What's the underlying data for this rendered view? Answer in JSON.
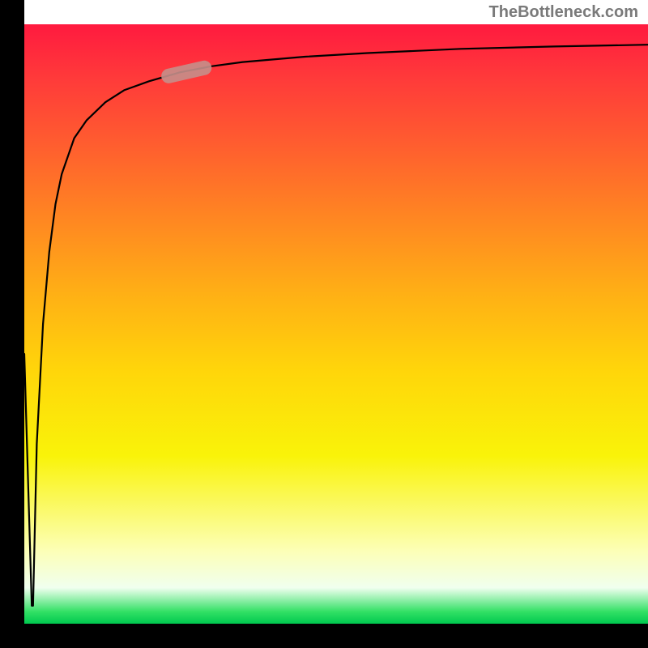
{
  "watermark": "TheBottleneck.com",
  "chart_data": {
    "type": "line",
    "title": "",
    "xlabel": "",
    "ylabel": "",
    "xlim": [
      0,
      100
    ],
    "ylim": [
      0,
      100
    ],
    "series": [
      {
        "name": "bottleneck-curve",
        "x": [
          0,
          1.2,
          1.4,
          2,
          3,
          4,
          5,
          6,
          8,
          10,
          13,
          16,
          20,
          25,
          30,
          35,
          45,
          55,
          70,
          85,
          100
        ],
        "values": [
          45,
          3,
          3,
          30,
          50,
          62,
          70,
          75,
          81,
          84,
          87,
          89,
          90.5,
          92,
          93,
          93.7,
          94.6,
          95.2,
          95.9,
          96.3,
          96.6
        ]
      }
    ],
    "annotations": [
      {
        "name": "highlight-segment",
        "x_range": [
          22,
          30
        ],
        "y_range": [
          84,
          88
        ],
        "color": "#c58f8b"
      }
    ],
    "gradient_stops": [
      {
        "pct": 0,
        "color": "#ff1a3f"
      },
      {
        "pct": 50,
        "color": "#ffd60a"
      },
      {
        "pct": 95,
        "color": "#f0ffef"
      },
      {
        "pct": 100,
        "color": "#00c94f"
      }
    ]
  }
}
